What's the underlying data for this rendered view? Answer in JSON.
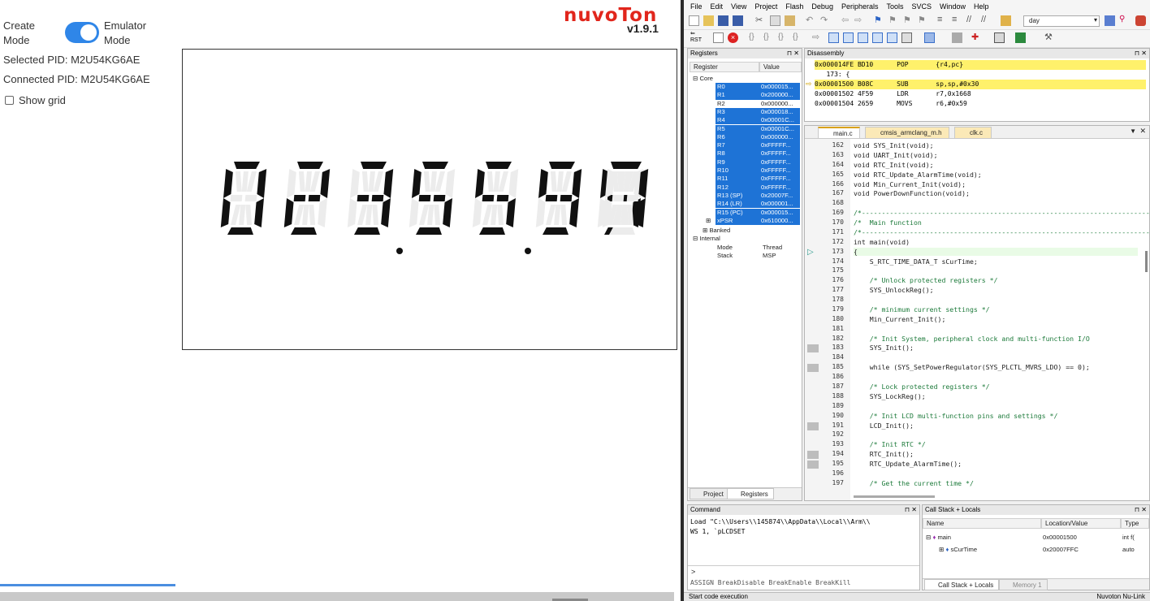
{
  "emulator": {
    "mode_left": "Create\nMode",
    "mode_right": "Emulator\nMode",
    "toggle_on": true,
    "selected_pid": "Selected PID: M2U54KG6AE",
    "connected_pid": "Connected PID: M2U54KG6AE",
    "show_grid_label": "Show grid",
    "show_grid_checked": false,
    "logo_text": "nuvoTon",
    "version": "v1.9.1",
    "display_text": "02:35:59:57",
    "display_digits": [
      "0",
      "2",
      "3",
      "5",
      "5",
      "9",
      "5",
      "7"
    ],
    "load_progress": 0.26,
    "colors": {
      "toggle": "#2f86e8",
      "logo": "#e1261c",
      "segment_on": "#111111",
      "segment_off": "#ececec"
    }
  },
  "ide": {
    "menu": [
      "File",
      "Edit",
      "View",
      "Project",
      "Flash",
      "Debug",
      "Peripherals",
      "Tools",
      "SVCS",
      "Window",
      "Help"
    ],
    "toolbar_combo_value": "day",
    "rst_label": "RST",
    "registers_panel": {
      "title": "Registers",
      "col_register": "Register",
      "col_value": "Value",
      "core_label": "Core",
      "rows": [
        {
          "name": "R0",
          "value": "0x000015...",
          "sel": true
        },
        {
          "name": "R1",
          "value": "0x200000...",
          "sel": true
        },
        {
          "name": "R2",
          "value": "0x000000...",
          "sel": false
        },
        {
          "name": "R3",
          "value": "0x000018...",
          "sel": true
        },
        {
          "name": "R4",
          "value": "0x00001C...",
          "sel": true
        },
        {
          "name": "R5",
          "value": "0x00001C...",
          "sel": true
        },
        {
          "name": "R6",
          "value": "0x000000...",
          "sel": true
        },
        {
          "name": "R7",
          "value": "0xFFFFF...",
          "sel": true
        },
        {
          "name": "R8",
          "value": "0xFFFFF...",
          "sel": true
        },
        {
          "name": "R9",
          "value": "0xFFFFF...",
          "sel": true
        },
        {
          "name": "R10",
          "value": "0xFFFFF...",
          "sel": true
        },
        {
          "name": "R11",
          "value": "0xFFFFF...",
          "sel": true
        },
        {
          "name": "R12",
          "value": "0xFFFFF...",
          "sel": true
        },
        {
          "name": "R13 (SP)",
          "value": "0x20007F...",
          "sel": true
        },
        {
          "name": "R14 (LR)",
          "value": "0x000001...",
          "sel": true
        },
        {
          "name": "R15 (PC)",
          "value": "0x000015...",
          "sel": true
        },
        {
          "name": "xPSR",
          "value": "0x610000...",
          "sel": true
        }
      ],
      "banked_label": "Banked",
      "internal_label": "Internal",
      "mode_label": "Mode",
      "mode_value": "Thread",
      "stack_label": "Stack",
      "stack_value": "MSP",
      "tab_project": "Project",
      "tab_registers": "Registers"
    },
    "disassembly": {
      "title": "Disassembly",
      "lines": [
        {
          "text": "0x000014FE BD10      POP       {r4,pc}",
          "hl": true
        },
        {
          "text": "   173: {",
          "hl": false
        },
        {
          "text": "0x00001500 B08C      SUB       sp,sp,#0x30",
          "hl": true
        },
        {
          "text": "0x00001502 4F59      LDR       r7,0x1668",
          "hl": false
        },
        {
          "text": "0x00001504 2659      MOVS      r6,#0x59",
          "hl": false
        }
      ]
    },
    "editor": {
      "tabs": [
        "main.c",
        "cmsis_armclang_m.h",
        "clk.c"
      ],
      "active_tab": "main.c",
      "lines": [
        {
          "n": "162",
          "t": "void SYS_Init(void);",
          "c": false,
          "b": false
        },
        {
          "n": "163",
          "t": "void UART_Init(void);",
          "c": false,
          "b": false
        },
        {
          "n": "164",
          "t": "void RTC_Init(void);",
          "c": false,
          "b": false
        },
        {
          "n": "165",
          "t": "void RTC_Update_AlarmTime(void);",
          "c": false,
          "b": false
        },
        {
          "n": "166",
          "t": "void Min_Current_Init(void);",
          "c": false,
          "b": false
        },
        {
          "n": "167",
          "t": "void PowerDownFunction(void);",
          "c": false,
          "b": false
        },
        {
          "n": "168",
          "t": "",
          "c": false,
          "b": false
        },
        {
          "n": "169",
          "t": "/*---------------------------------------------------------------------------",
          "c": true,
          "b": false
        },
        {
          "n": "170",
          "t": "/*  Main function",
          "c": true,
          "b": false
        },
        {
          "n": "171",
          "t": "/*---------------------------------------------------------------------------",
          "c": true,
          "b": false
        },
        {
          "n": "172",
          "t": "int main(void)",
          "c": false,
          "b": false
        },
        {
          "n": "173",
          "t": "{",
          "c": false,
          "b": false,
          "cur": true
        },
        {
          "n": "174",
          "t": "    S_RTC_TIME_DATA_T sCurTime;",
          "c": false,
          "b": false
        },
        {
          "n": "175",
          "t": "",
          "c": false,
          "b": false
        },
        {
          "n": "176",
          "t": "    /* Unlock protected registers */",
          "c": true,
          "b": false
        },
        {
          "n": "177",
          "t": "    SYS_UnlockReg();",
          "c": false,
          "b": false
        },
        {
          "n": "178",
          "t": "",
          "c": false,
          "b": false
        },
        {
          "n": "179",
          "t": "    /* minimum current settings */",
          "c": true,
          "b": false
        },
        {
          "n": "180",
          "t": "    Min_Current_Init();",
          "c": false,
          "b": false
        },
        {
          "n": "181",
          "t": "",
          "c": false,
          "b": false
        },
        {
          "n": "182",
          "t": "    /* Init System, peripheral clock and multi-function I/O",
          "c": true,
          "b": false
        },
        {
          "n": "183",
          "t": "    SYS_Init();",
          "c": false,
          "b": true
        },
        {
          "n": "184",
          "t": "",
          "c": false,
          "b": false
        },
        {
          "n": "185",
          "t": "    while (SYS_SetPowerRegulator(SYS_PLCTL_MVRS_LDO) == 0);",
          "c": false,
          "b": true
        },
        {
          "n": "186",
          "t": "",
          "c": false,
          "b": false
        },
        {
          "n": "187",
          "t": "    /* Lock protected registers */",
          "c": true,
          "b": false
        },
        {
          "n": "188",
          "t": "    SYS_LockReg();",
          "c": false,
          "b": false
        },
        {
          "n": "189",
          "t": "",
          "c": false,
          "b": false
        },
        {
          "n": "190",
          "t": "    /* Init LCD multi-function pins and settings */",
          "c": true,
          "b": false
        },
        {
          "n": "191",
          "t": "    LCD_Init();",
          "c": false,
          "b": true
        },
        {
          "n": "192",
          "t": "",
          "c": false,
          "b": false
        },
        {
          "n": "193",
          "t": "    /* Init RTC */",
          "c": true,
          "b": false
        },
        {
          "n": "194",
          "t": "    RTC_Init();",
          "c": false,
          "b": true
        },
        {
          "n": "195",
          "t": "    RTC_Update_AlarmTime();",
          "c": false,
          "b": true
        },
        {
          "n": "196",
          "t": "",
          "c": false,
          "b": false
        },
        {
          "n": "197",
          "t": "    /* Get the current time */",
          "c": true,
          "b": false
        }
      ]
    },
    "command": {
      "title": "Command",
      "lines": [
        "Load \"C:\\\\Users\\\\145874\\\\AppData\\\\Local\\\\Arm\\\\",
        "WS 1, `pLCDSET"
      ],
      "prompt": ">",
      "hint": "ASSIGN BreakDisable BreakEnable BreakKill"
    },
    "callstack": {
      "title": "Call Stack + Locals",
      "col_name": "Name",
      "col_loc": "Location/Value",
      "col_type": "Type",
      "rows": [
        {
          "name": "main",
          "loc": "0x00001500",
          "type": "int f("
        },
        {
          "name": "sCurTime",
          "loc": "0x20007FFC",
          "type": "auto"
        }
      ],
      "tab_callstack": "Call Stack + Locals",
      "tab_memory": "Memory 1"
    },
    "status_left": "Start code execution",
    "status_right": "Nuvoton Nu-Link"
  }
}
